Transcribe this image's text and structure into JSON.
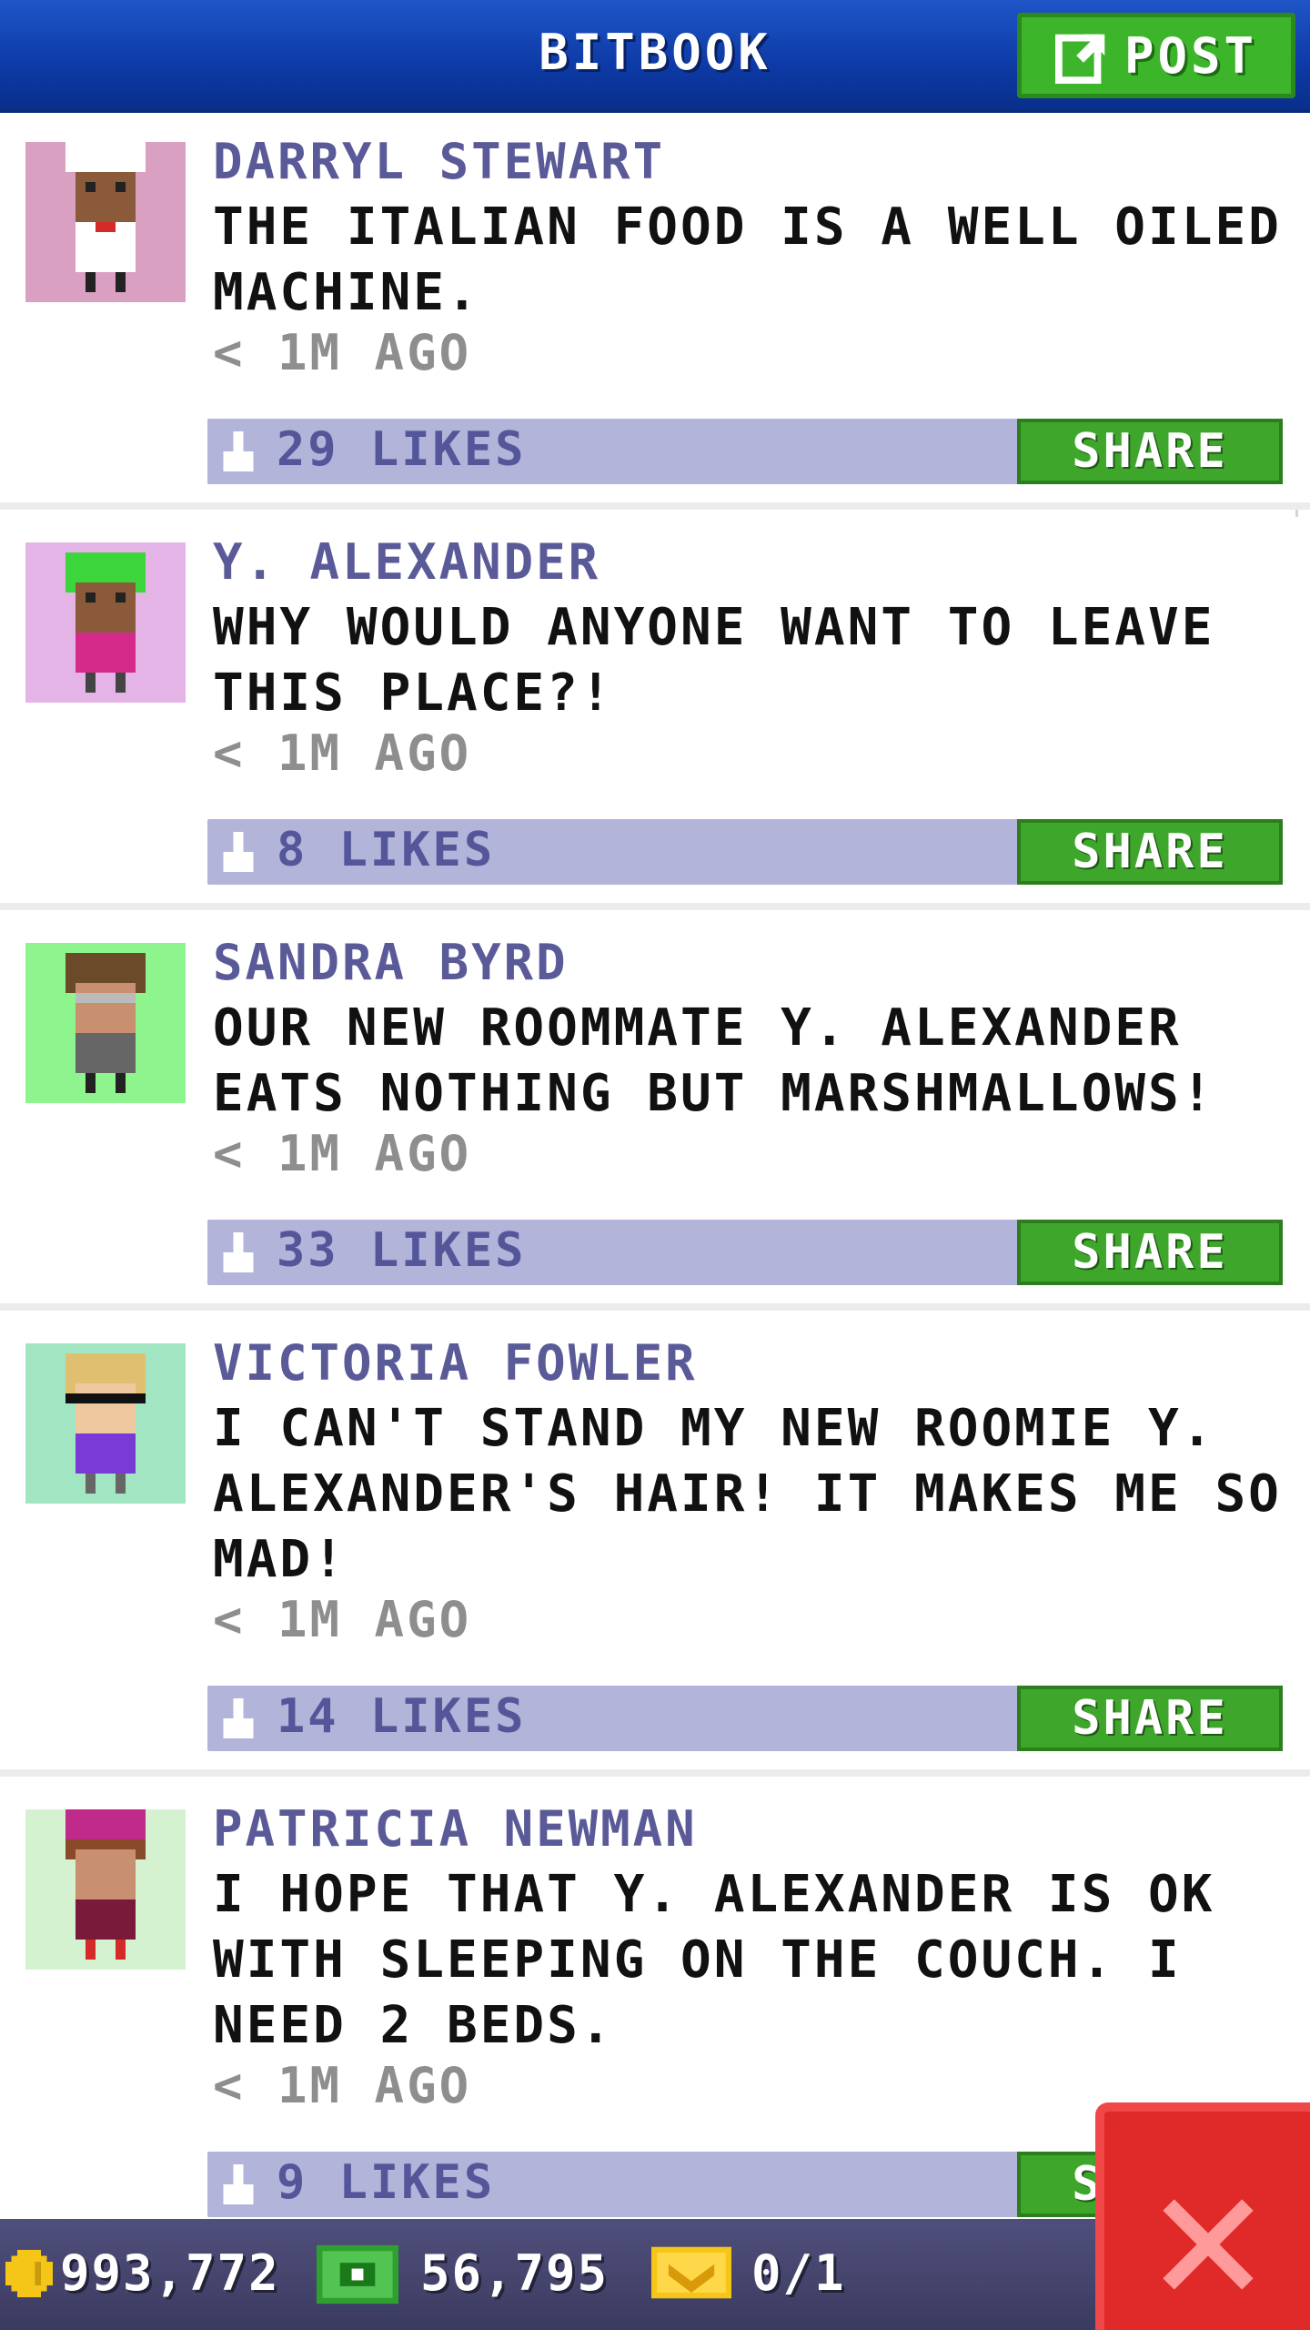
{
  "header": {
    "title": "BITBOOK",
    "post_label": "POST"
  },
  "posts": [
    {
      "author": "DARRYL STEWART",
      "message": "THE ITALIAN FOOD IS A WELL OILED MACHINE.",
      "time": "< 1M AGO",
      "likes": "29 LIKES",
      "share_label": "SHARE",
      "avatar_bg": "#d9a0c2"
    },
    {
      "author": "Y. ALEXANDER",
      "message": "WHY WOULD ANYONE WANT TO LEAVE THIS PLACE?!",
      "time": "< 1M AGO",
      "likes": "8 LIKES",
      "share_label": "SHARE",
      "avatar_bg": "#e4b4e6"
    },
    {
      "author": "SANDRA BYRD",
      "message": "OUR NEW ROOMMATE Y. ALEXANDER EATS NOTHING BUT MARSHMALLOWS!",
      "time": "< 1M AGO",
      "likes": "33 LIKES",
      "share_label": "SHARE",
      "avatar_bg": "#8ef58e"
    },
    {
      "author": "VICTORIA FOWLER",
      "message": "I CAN'T STAND MY NEW ROOMIE Y. ALEXANDER'S HAIR! IT MAKES ME SO MAD!",
      "time": "< 1M AGO",
      "likes": "14 LIKES",
      "share_label": "SHARE",
      "avatar_bg": "#a2e5c2"
    },
    {
      "author": "PATRICIA NEWMAN",
      "message": "I HOPE THAT Y. ALEXANDER IS OK WITH SLEEPING ON THE COUCH. I NEED 2 BEDS.",
      "time": "< 1M AGO",
      "likes": "9 LIKES",
      "share_label": "SHARE",
      "avatar_bg": "#d4f2d0"
    }
  ],
  "status": {
    "coins": "993,772",
    "bux": "56,795",
    "tickets": "0/1"
  },
  "icons": {
    "post": "compose-icon",
    "like": "thumbs-up-icon",
    "coin": "coin-icon",
    "bux": "bux-icon",
    "ticket": "ticket-icon",
    "close": "close-icon"
  },
  "colors": {
    "header": "#0d3aa6",
    "accent_green": "#3fa62c",
    "likes_bar": "#b3b4d9",
    "author_text": "#5a5a98",
    "close_red": "#e02a2a"
  }
}
